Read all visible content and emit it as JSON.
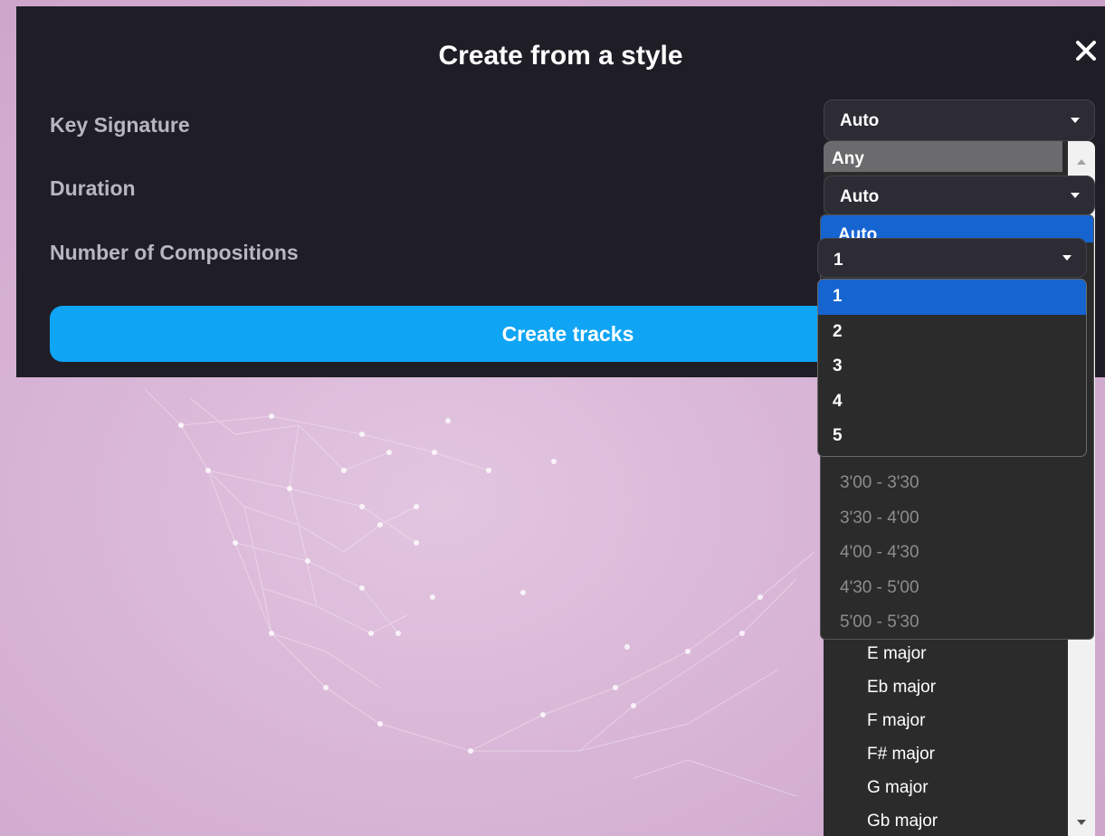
{
  "dialog": {
    "title": "Create from a style",
    "fields": {
      "key_signature_label": "Key Signature",
      "duration_label": "Duration",
      "compositions_label": "Number of Compositions"
    },
    "create_button_label": "Create tracks"
  },
  "key_signature_select": {
    "value": "Auto",
    "first_option": "Any",
    "visible_options": [
      "E major",
      "Eb major",
      "F major",
      "F# major",
      "G major",
      "Gb major"
    ]
  },
  "duration_select": {
    "value": "Auto",
    "highlighted_option": "Auto",
    "visible_options": [
      "3'00 - 3'30",
      "3'30 - 4'00",
      "4'00 - 4'30",
      "4'30 - 5'00",
      "5'00 - 5'30"
    ]
  },
  "compositions_select": {
    "value": "1",
    "options": [
      "1",
      "2",
      "3",
      "4",
      "5"
    ],
    "selected_option": "1"
  },
  "colors": {
    "dialog_bg": "#1f1e26",
    "accent_button": "#10a5f4",
    "selected_option": "#1564cf",
    "background": "#d7b3d5"
  },
  "icons": {
    "close": "close-icon",
    "dropdown": "chevron-down-icon"
  }
}
